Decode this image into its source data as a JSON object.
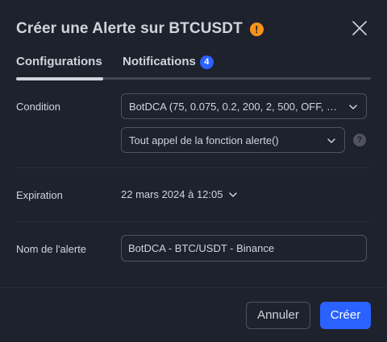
{
  "dialog": {
    "title": "Créer une Alerte sur BTCUSDT",
    "warning_icon": "exclamation-icon",
    "warning_glyph": "!",
    "close_icon": "close-icon"
  },
  "tabs": [
    {
      "label": "Configurations",
      "active": true
    },
    {
      "label": "Notifications",
      "badge": "4",
      "active": false
    }
  ],
  "condition": {
    "label": "Condition",
    "indicator_value": "BotDCA (75, 0.075, 0.2, 200, 2, 500, OFF, 0.0002, ...",
    "trigger_value": "Tout appel de la fonction alerte()",
    "help_glyph": "?"
  },
  "expiration": {
    "label": "Expiration",
    "value": "22 mars 2024 à 12:05"
  },
  "alert_name": {
    "label": "Nom de l'alerte",
    "value": "BotDCA - BTC/USDT - Binance"
  },
  "footer": {
    "cancel_label": "Annuler",
    "create_label": "Créer"
  },
  "colors": {
    "background": "#1e222d",
    "accent": "#2962ff",
    "warning": "#f7931a",
    "text": "#d1d4dc",
    "border": "#50535e"
  }
}
